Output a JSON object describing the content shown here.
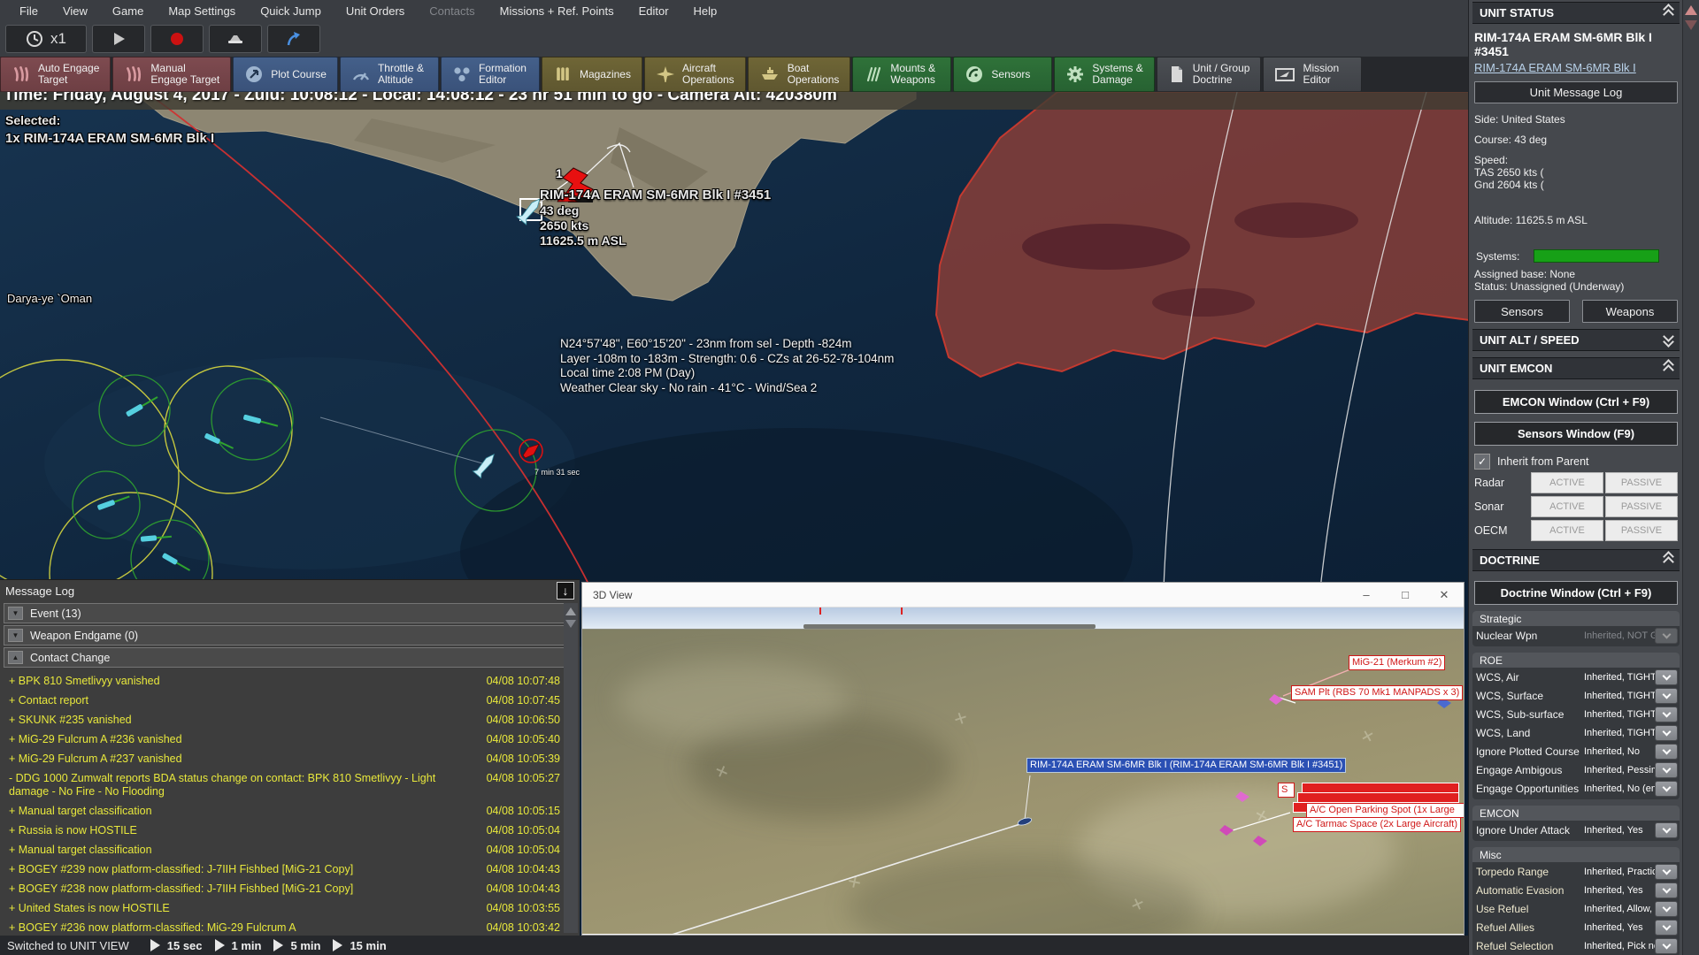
{
  "menu_bar": {
    "items": [
      "File",
      "View",
      "Game",
      "Map Settings",
      "Quick Jump",
      "Unit Orders",
      "Contacts",
      "Missions + Ref. Points",
      "Editor",
      "Help"
    ],
    "disabled_items": [
      "Contacts"
    ]
  },
  "quick_toolbar": {
    "time_compression": "x1",
    "icons": [
      "clock-icon",
      "play-icon",
      "record-icon",
      "screenshot-icon",
      "jump-icon"
    ]
  },
  "main_toolbar": {
    "buttons": [
      {
        "line1": "Auto Engage",
        "line2": "Target",
        "group": "engage",
        "icon": "talon-icon"
      },
      {
        "line1": "Manual",
        "line2": "Engage Target",
        "group": "engage",
        "icon": "talon-icon"
      },
      {
        "line1": "Plot Course",
        "line2": "",
        "group": "nav",
        "icon": "plot-course-icon"
      },
      {
        "line1": "Throttle &",
        "line2": "Altitude",
        "group": "nav",
        "icon": "throttle-icon"
      },
      {
        "line1": "Formation",
        "line2": "Editor",
        "group": "nav",
        "icon": "formation-icon"
      },
      {
        "line1": "Magazines",
        "line2": "",
        "group": "ops",
        "icon": "magazines-icon"
      },
      {
        "line1": "Aircraft",
        "line2": "Operations",
        "group": "ops",
        "icon": "aircraft-icon"
      },
      {
        "line1": "Boat",
        "line2": "Operations",
        "group": "ops",
        "icon": "boat-icon"
      },
      {
        "line1": "Mounts &",
        "line2": "Weapons",
        "group": "weapons",
        "icon": "mounts-icon"
      },
      {
        "line1": "Sensors",
        "line2": "",
        "group": "weapons",
        "icon": "sensors-icon"
      },
      {
        "line1": "Systems &",
        "line2": "Damage",
        "group": "weapons",
        "icon": "gear-icon"
      },
      {
        "line1": "Unit / Group",
        "line2": "Doctrine",
        "group": "misc",
        "icon": "doctrine-icon"
      },
      {
        "line1": "Mission",
        "line2": "Editor",
        "group": "misc",
        "icon": "mission-editor-icon"
      }
    ]
  },
  "time_bar": {
    "text": "Time: Friday, August 4, 2017 - Zulu: 10:08:12 - Local: 14:08:12 - 23 hr 51 min to go -  Camera Alt: 420380m"
  },
  "selection": {
    "label": "Selected:",
    "value": "1x RIM-174A ERAM SM-6MR Blk I"
  },
  "map": {
    "sea_label": "Darya-ye `Oman",
    "hostile_contact_count": "1",
    "selected_unit": {
      "name": "RIM-174A ERAM SM-6MR Blk I #3451",
      "course": "43 deg",
      "speed": "2650 kts",
      "altitude": "11625.5 m ASL"
    },
    "cursor_info": [
      "N24°57'48\", E60°15'20\" - 23nm from sel - Depth -824m",
      "Layer -108m to -183m - Strength: 0.6 - CZs at 26-52-78-104nm",
      "Local time 2:08 PM (Day)",
      "Weather Clear sky - No rain - 41°C - Wind/Sea 2"
    ],
    "intercept_eta": "7 min 31 sec"
  },
  "message_log": {
    "title": "Message Log",
    "export_icon": "download-icon",
    "groups": [
      {
        "label": "Event (13)",
        "expanded": false
      },
      {
        "label": "Weapon Endgame (0)",
        "expanded": false
      },
      {
        "label": "Contact Change",
        "expanded": true
      }
    ],
    "entries": [
      {
        "prefix": "+",
        "text": "BPK 810 Smetlivyy vanished",
        "time": "04/08 10:07:48"
      },
      {
        "prefix": "+",
        "text": "Contact report",
        "time": "04/08 10:07:45"
      },
      {
        "prefix": "+",
        "text": "SKUNK #235 vanished",
        "time": "04/08 10:06:50"
      },
      {
        "prefix": "+",
        "text": "MiG-29 Fulcrum A #236 vanished",
        "time": "04/08 10:05:40"
      },
      {
        "prefix": "+",
        "text": "MiG-29 Fulcrum A #237 vanished",
        "time": "04/08 10:05:39"
      },
      {
        "prefix": "-",
        "text": "DDG 1000 Zumwalt reports BDA status change on contact: BPK 810 Smetlivyy - Light damage - No Fire - No Flooding",
        "time": "04/08 10:05:27"
      },
      {
        "prefix": "+",
        "text": "Manual target classification",
        "time": "04/08 10:05:15"
      },
      {
        "prefix": "+",
        "text": "Russia is now HOSTILE",
        "time": "04/08 10:05:04"
      },
      {
        "prefix": "+",
        "text": "Manual target classification",
        "time": "04/08 10:05:04"
      },
      {
        "prefix": "+",
        "text": "BOGEY #239 now platform-classified: J-7IIH Fishbed [MiG-21 Copy]",
        "time": "04/08 10:04:43"
      },
      {
        "prefix": "+",
        "text": "BOGEY #238 now platform-classified: J-7IIH Fishbed [MiG-21 Copy]",
        "time": "04/08 10:04:43"
      },
      {
        "prefix": "+",
        "text": "United States is now HOSTILE",
        "time": "04/08 10:03:55"
      },
      {
        "prefix": "+",
        "text": "BOGEY #236 now platform-classified: MiG-29 Fulcrum A",
        "time": "04/08 10:03:42"
      }
    ]
  },
  "view_3d": {
    "title": "3D View",
    "window_buttons": [
      "minimize",
      "maximize",
      "close"
    ],
    "labels": {
      "contact_air": "MiG-21 (Merkum #2)",
      "contact_sam": "SAM Plt (RBS 70 Mk1 MANPADS x 3)",
      "own_weapon": "RIM-174A ERAM SM-6MR Blk I (RIM-174A ERAM SM-6MR Blk I #3451)",
      "facility_parking": "A/C Open Parking Spot (1x Large",
      "facility_tarmac": "A/C Tarmac Space (2x Large Aircraft)",
      "facility_small": "S"
    }
  },
  "status_bar": {
    "message": "Switched to UNIT VIEW",
    "time_steps": [
      "15 sec",
      "1 min",
      "5 min",
      "15 min"
    ]
  },
  "unit_panel": {
    "status_header": "UNIT STATUS",
    "unit_name": "RIM-174A ERAM SM-6MR Blk I #3451",
    "unit_class_link": "RIM-174A ERAM SM-6MR Blk I",
    "message_log_button": "Unit Message Log",
    "side": "Side: United States",
    "course": "Course: 43 deg",
    "speed_label": "Speed:",
    "speed_tas": "TAS 2650 kts (",
    "speed_gnd": "Gnd 2604 kts (",
    "altitude": "Altitude: 11625.5 m ASL",
    "systems_label": "Systems:",
    "assigned_base": "Assigned base: None",
    "status": "Status: Unassigned (Underway)",
    "sensors_button": "Sensors",
    "weapons_button": "Weapons",
    "alt_speed_header": "UNIT ALT / SPEED",
    "emcon": {
      "header": "UNIT EMCON",
      "emcon_window_button": "EMCON Window (Ctrl + F9)",
      "sensors_window_button": "Sensors Window (F9)",
      "inherit_label": "Inherit from Parent",
      "inherit_checked": true,
      "active_label": "ACTIVE",
      "passive_label": "PASSIVE",
      "rows": [
        {
          "label": "Radar"
        },
        {
          "label": "Sonar"
        },
        {
          "label": "OECM"
        }
      ]
    },
    "doctrine": {
      "header": "DOCTRINE",
      "window_button": "Doctrine Window (Ctrl + F9)",
      "groups": [
        {
          "title": "Strategic",
          "kind": "strategic",
          "rows": [
            {
              "label": "Nuclear Wpn",
              "value": "Inherited, NOT G",
              "disabled": true
            }
          ]
        },
        {
          "title": "ROE",
          "kind": "roe",
          "rows": [
            {
              "label": "WCS, Air",
              "value": "Inherited, TIGHT"
            },
            {
              "label": "WCS, Surface",
              "value": "Inherited, TIGHT"
            },
            {
              "label": "WCS, Sub-surface",
              "value": "Inherited, TIGHT"
            },
            {
              "label": "WCS, Land",
              "value": "Inherited, TIGHT"
            },
            {
              "label": "Ignore Plotted Course",
              "value": "Inherited, No"
            },
            {
              "label": "Engage Ambigous",
              "value": "Inherited, Pessim"
            },
            {
              "label": "Engage Opportunities",
              "value": "Inherited, No (en"
            }
          ]
        },
        {
          "title": "EMCON",
          "kind": "emcon",
          "rows": [
            {
              "label": "Ignore Under Attack",
              "value": "Inherited, Yes"
            }
          ]
        },
        {
          "title": "Misc",
          "kind": "misc",
          "rows": [
            {
              "label": "Torpedo Range",
              "value": "Inherited, Practic"
            },
            {
              "label": "Automatic Evasion",
              "value": "Inherited, Yes"
            },
            {
              "label": "Use Refuel",
              "value": "Inherited, Allow, I"
            },
            {
              "label": "Refuel Allies",
              "value": "Inherited, Yes"
            },
            {
              "label": "Refuel Selection",
              "value": "Inherited, Pick ne"
            }
          ]
        }
      ]
    }
  },
  "colors": {
    "hostile_red": "#e01010",
    "friendly_blue": "#2b50b4",
    "log_yellow": "#e8e83c",
    "systems_ok_green": "#17a017"
  }
}
